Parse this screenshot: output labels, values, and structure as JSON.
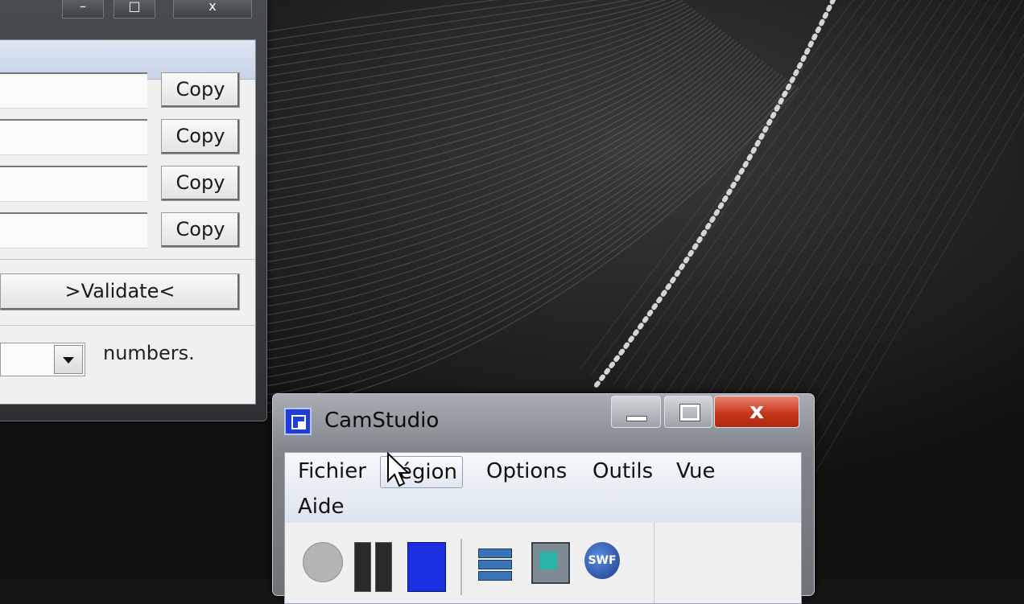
{
  "left_window": {
    "controls": {
      "minimize": "–",
      "maximize": "□",
      "close": "x"
    },
    "copy_buttons": [
      "Copy",
      "Copy",
      "Copy",
      "Copy"
    ],
    "validate_label": ">Validate<",
    "combo_label": "numbers."
  },
  "camstudio": {
    "title": "CamStudio",
    "menu": [
      "Fichier",
      "Région",
      "Options",
      "Outils",
      "Vue",
      "Aide"
    ],
    "highlighted_menu": "Région",
    "close_glyph": "x",
    "toolbar_icons": [
      "record-icon",
      "pause-icon",
      "stop-icon",
      "annotate-icon",
      "region-video-icon",
      "swf-icon"
    ],
    "swf_text": "SWF"
  },
  "colors": {
    "close_red": "#c6381c",
    "stop_blue": "#1a2fe0",
    "desktop": "#161616"
  }
}
